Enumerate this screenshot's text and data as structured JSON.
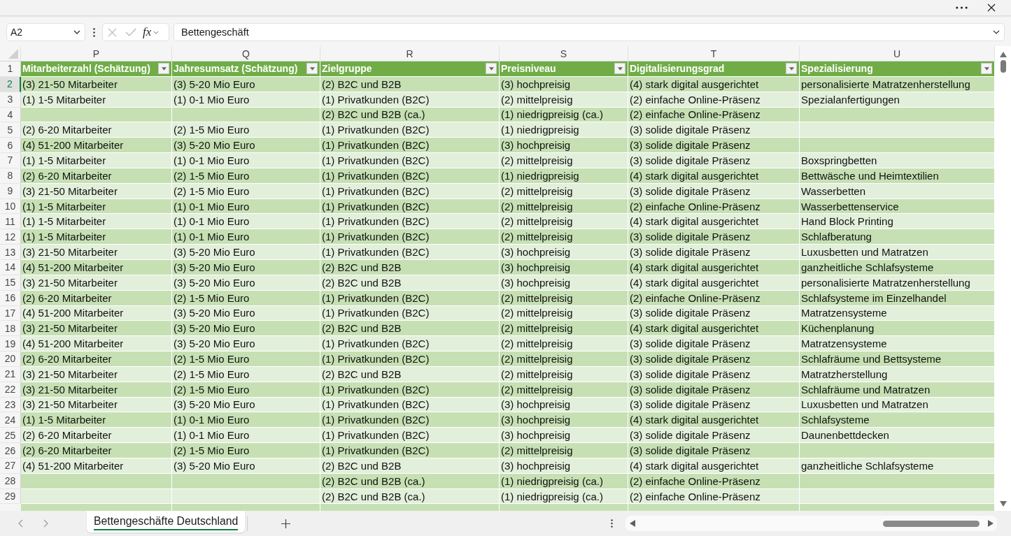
{
  "formula_bar": {
    "name_box": "A2",
    "function_label": "fx",
    "formula": "Bettengeschäft"
  },
  "sheet": {
    "columns": [
      "P",
      "Q",
      "R",
      "S",
      "T",
      "U"
    ],
    "header_row_number": "1",
    "headers": [
      "Mitarbeiterzahl (Schätzung)",
      "Jahresumsatz (Schätzung)",
      "Zielgruppe",
      "Preisniveau",
      "Digitalisierungsgrad",
      "Spezialisierung"
    ],
    "rows": [
      {
        "number": "2",
        "selected": true,
        "cells": [
          "(3) 21-50 Mitarbeiter",
          "(3) 5-20 Mio Euro",
          "(2) B2C und B2B",
          "(3) hochpreisig",
          "(4) stark digital ausgerichtet",
          "personalisierte Matratzenherstellung"
        ]
      },
      {
        "number": "3",
        "selected": false,
        "cells": [
          "(1) 1-5 Mitarbeiter",
          "(1) 0-1 Mio Euro",
          "(1) Privatkunden (B2C)",
          "(2) mittelpreisig",
          "(2) einfache Online-Präsenz",
          "Spezialanfertigungen"
        ]
      },
      {
        "number": "4",
        "selected": false,
        "cells": [
          null,
          null,
          "(2) B2C und B2B (ca.)",
          "(1) niedrigpreisig (ca.)",
          "(2) einfache Online-Präsenz",
          null
        ]
      },
      {
        "number": "5",
        "selected": false,
        "cells": [
          "(2) 6-20 Mitarbeiter",
          "(2) 1-5 Mio Euro",
          "(1) Privatkunden (B2C)",
          "(1) niedrigpreisig",
          "(3) solide digitale Präsenz",
          null
        ]
      },
      {
        "number": "6",
        "selected": false,
        "cells": [
          "(4) 51-200 Mitarbeiter",
          "(3) 5-20 Mio Euro",
          "(1) Privatkunden (B2C)",
          "(3) hochpreisig",
          "(3) solide digitale Präsenz",
          null
        ]
      },
      {
        "number": "7",
        "selected": false,
        "cells": [
          "(1) 1-5 Mitarbeiter",
          "(1) 0-1 Mio Euro",
          "(1) Privatkunden (B2C)",
          "(2) mittelpreisig",
          "(3) solide digitale Präsenz",
          "Boxspringbetten"
        ]
      },
      {
        "number": "8",
        "selected": false,
        "cells": [
          "(2) 6-20 Mitarbeiter",
          "(2) 1-5 Mio Euro",
          "(1) Privatkunden (B2C)",
          "(1) niedrigpreisig",
          "(4) stark digital ausgerichtet",
          "Bettwäsche und Heimtextilien"
        ]
      },
      {
        "number": "9",
        "selected": false,
        "cells": [
          "(3) 21-50 Mitarbeiter",
          "(2) 1-5 Mio Euro",
          "(1) Privatkunden (B2C)",
          "(2) mittelpreisig",
          "(3) solide digitale Präsenz",
          "Wasserbetten"
        ]
      },
      {
        "number": "10",
        "selected": false,
        "cells": [
          "(1) 1-5 Mitarbeiter",
          "(1) 0-1 Mio Euro",
          "(1) Privatkunden (B2C)",
          "(2) mittelpreisig",
          "(2) einfache Online-Präsenz",
          "Wasserbettenservice"
        ]
      },
      {
        "number": "11",
        "selected": false,
        "cells": [
          "(1) 1-5 Mitarbeiter",
          "(1) 0-1 Mio Euro",
          "(1) Privatkunden (B2C)",
          "(2) mittelpreisig",
          "(4) stark digital ausgerichtet",
          "Hand Block Printing"
        ]
      },
      {
        "number": "12",
        "selected": false,
        "cells": [
          "(1) 1-5 Mitarbeiter",
          "(1) 0-1 Mio Euro",
          "(1) Privatkunden (B2C)",
          "(2) mittelpreisig",
          "(3) solide digitale Präsenz",
          "Schlafberatung"
        ]
      },
      {
        "number": "13",
        "selected": false,
        "cells": [
          "(3) 21-50 Mitarbeiter",
          "(3) 5-20 Mio Euro",
          "(1) Privatkunden (B2C)",
          "(3) hochpreisig",
          "(3) solide digitale Präsenz",
          "Luxusbetten und Matratzen"
        ]
      },
      {
        "number": "14",
        "selected": false,
        "cells": [
          "(4) 51-200 Mitarbeiter",
          "(3) 5-20 Mio Euro",
          "(2) B2C und B2B",
          "(3) hochpreisig",
          "(4) stark digital ausgerichtet",
          "ganzheitliche Schlafsysteme"
        ]
      },
      {
        "number": "15",
        "selected": false,
        "cells": [
          "(3) 21-50 Mitarbeiter",
          "(3) 5-20 Mio Euro",
          "(2) B2C und B2B",
          "(3) hochpreisig",
          "(4) stark digital ausgerichtet",
          "personalisierte Matratzenherstellung"
        ]
      },
      {
        "number": "16",
        "selected": false,
        "cells": [
          "(2) 6-20 Mitarbeiter",
          "(2) 1-5 Mio Euro",
          "(1) Privatkunden (B2C)",
          "(2) mittelpreisig",
          "(2) einfache Online-Präsenz",
          "Schlafsysteme im Einzelhandel"
        ]
      },
      {
        "number": "17",
        "selected": false,
        "cells": [
          "(4) 51-200 Mitarbeiter",
          "(3) 5-20 Mio Euro",
          "(1) Privatkunden (B2C)",
          "(2) mittelpreisig",
          "(3) solide digitale Präsenz",
          "Matratzensysteme"
        ]
      },
      {
        "number": "18",
        "selected": false,
        "cells": [
          "(3) 21-50 Mitarbeiter",
          "(3) 5-20 Mio Euro",
          "(2) B2C und B2B",
          "(2) mittelpreisig",
          "(4) stark digital ausgerichtet",
          "Küchenplanung"
        ]
      },
      {
        "number": "19",
        "selected": false,
        "cells": [
          "(4) 51-200 Mitarbeiter",
          "(3) 5-20 Mio Euro",
          "(1) Privatkunden (B2C)",
          "(2) mittelpreisig",
          "(3) solide digitale Präsenz",
          "Matratzensysteme"
        ]
      },
      {
        "number": "20",
        "selected": false,
        "cells": [
          "(2) 6-20 Mitarbeiter",
          "(2) 1-5 Mio Euro",
          "(1) Privatkunden (B2C)",
          "(2) mittelpreisig",
          "(3) solide digitale Präsenz",
          "Schlafräume und Bettsysteme"
        ]
      },
      {
        "number": "21",
        "selected": false,
        "cells": [
          "(3) 21-50 Mitarbeiter",
          "(2) 1-5 Mio Euro",
          "(2) B2C und B2B",
          "(2) mittelpreisig",
          "(3) solide digitale Präsenz",
          "Matratzherstellung"
        ]
      },
      {
        "number": "22",
        "selected": false,
        "cells": [
          "(3) 21-50 Mitarbeiter",
          "(2) 1-5 Mio Euro",
          "(1) Privatkunden (B2C)",
          "(2) mittelpreisig",
          "(3) solide digitale Präsenz",
          "Schlafräume und Matratzen"
        ]
      },
      {
        "number": "23",
        "selected": false,
        "cells": [
          "(3) 21-50 Mitarbeiter",
          "(3) 5-20 Mio Euro",
          "(1) Privatkunden (B2C)",
          "(3) hochpreisig",
          "(3) solide digitale Präsenz",
          "Luxusbetten und Matratzen"
        ]
      },
      {
        "number": "24",
        "selected": false,
        "cells": [
          "(1) 1-5 Mitarbeiter",
          "(1) 0-1 Mio Euro",
          "(1) Privatkunden (B2C)",
          "(3) hochpreisig",
          "(4) stark digital ausgerichtet",
          "Schlafsysteme"
        ]
      },
      {
        "number": "25",
        "selected": false,
        "cells": [
          "(2) 6-20 Mitarbeiter",
          "(1) 0-1 Mio Euro",
          "(1) Privatkunden (B2C)",
          "(3) hochpreisig",
          "(3) solide digitale Präsenz",
          "Daunenbettdecken"
        ]
      },
      {
        "number": "26",
        "selected": false,
        "cells": [
          "(2) 6-20 Mitarbeiter",
          "(2) 1-5 Mio Euro",
          "(1) Privatkunden (B2C)",
          "(2) mittelpreisig",
          "(3) solide digitale Präsenz",
          null
        ]
      },
      {
        "number": "27",
        "selected": false,
        "cells": [
          "(4) 51-200 Mitarbeiter",
          "(3) 5-20 Mio Euro",
          "(2) B2C und B2B",
          "(3) hochpreisig",
          "(4) stark digital ausgerichtet",
          "ganzheitliche Schlafsysteme"
        ]
      },
      {
        "number": "28",
        "selected": false,
        "cells": [
          null,
          null,
          "(2) B2C und B2B (ca.)",
          "(1) niedrigpreisig (ca.)",
          "(2) einfache Online-Präsenz",
          null
        ]
      },
      {
        "number": "29",
        "selected": false,
        "cells": [
          null,
          null,
          "(2) B2C und B2B (ca.)",
          "(1) niedrigpreisig (ca.)",
          "(2) einfache Online-Präsenz",
          null
        ]
      }
    ]
  },
  "sheet_tabs": [
    {
      "label": "Bettengeschäfte Deutschland",
      "selected": true
    }
  ]
}
